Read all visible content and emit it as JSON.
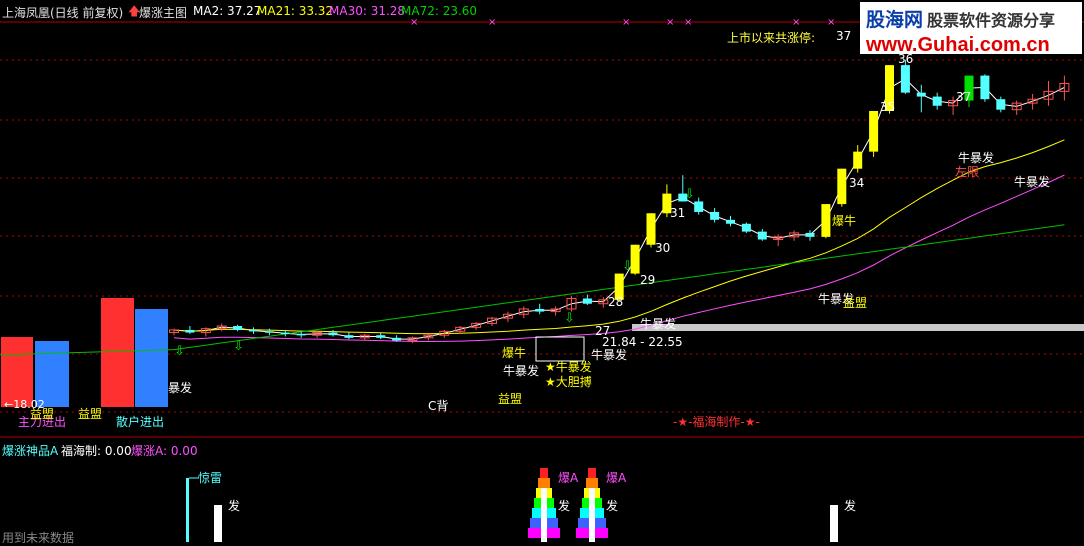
{
  "header": {
    "stock": "上海凤凰(日线 前复权)",
    "indicator": "爆涨主图",
    "ma2": "MA2: 37.27",
    "ma21": "MA21: 33.32",
    "ma30": "MA30: 31.28",
    "ma72": "MA72: 23.60"
  },
  "since_listing": {
    "label": "上市以来共涨停:",
    "value": "37"
  },
  "logo": {
    "cn_main": "股海网",
    "cn_sub": "股票软件资源分享",
    "url": "www.Guhai.com.cn"
  },
  "annotations": {
    "zhuli": "主力进出",
    "sanhu": "散户进出",
    "yimeng": "益盟",
    "wanjia": "←18.02",
    "baofa": "暴发",
    "niubaofa": "牛暴发",
    "baoniu": "爆牛",
    "dadanbo": "大胆搏",
    "cbei": "C背",
    "youjiang": "左限",
    "range_box": "21.84 - 22.55",
    "credit": "-★-福海制作-★-",
    "xin": "★",
    "n31": "31",
    "n30": "30",
    "n29": "29",
    "n34": "34",
    "n35": "35",
    "n36": "36",
    "n37": "37",
    "n28": "28",
    "n27": "27"
  },
  "sub_panel": {
    "title": "爆涨神品A",
    "fuhai": "福海制: 0.00",
    "baozhangA": "爆涨A: 0.00",
    "jinglei": "惊雷",
    "fa": "发",
    "baoA": "爆A",
    "future": "用到未来数据"
  },
  "colors": {
    "up": "#ff5050",
    "down": "#54ffff",
    "yellow": "#ffff00",
    "ma2": "#ffffff",
    "ma21": "#ffff00",
    "ma30": "#ff50ff",
    "ma72": "#00c000",
    "grid": "#b40000"
  },
  "chart_data": {
    "type": "candlestick",
    "title": "爆涨主图",
    "ylim": [
      12,
      39
    ],
    "series_ma": [
      {
        "name": "MA2",
        "value": 37.27
      },
      {
        "name": "MA21",
        "value": 33.32
      },
      {
        "name": "MA30",
        "value": 31.28
      },
      {
        "name": "MA72",
        "value": 23.6
      }
    ],
    "candles": [
      [
        17.6,
        17.9,
        17.4,
        17.8
      ],
      [
        17.8,
        18.1,
        17.5,
        17.6
      ],
      [
        17.6,
        18.0,
        17.3,
        17.9
      ],
      [
        17.9,
        18.3,
        17.7,
        18.1
      ],
      [
        18.1,
        18.2,
        17.7,
        17.8
      ],
      [
        17.8,
        18.0,
        17.5,
        17.7
      ],
      [
        17.7,
        17.9,
        17.4,
        17.6
      ],
      [
        17.6,
        17.8,
        17.3,
        17.5
      ],
      [
        17.5,
        17.7,
        17.2,
        17.4
      ],
      [
        17.4,
        17.7,
        17.2,
        17.6
      ],
      [
        17.6,
        17.8,
        17.3,
        17.4
      ],
      [
        17.4,
        17.6,
        17.1,
        17.2
      ],
      [
        17.2,
        17.5,
        17.0,
        17.4
      ],
      [
        17.4,
        17.6,
        17.1,
        17.2
      ],
      [
        17.2,
        17.4,
        16.9,
        17.0
      ],
      [
        17.0,
        17.3,
        16.8,
        17.2
      ],
      [
        17.2,
        17.5,
        17.0,
        17.4
      ],
      [
        17.4,
        17.8,
        17.2,
        17.7
      ],
      [
        17.7,
        18.1,
        17.5,
        18.0
      ],
      [
        18.0,
        18.4,
        17.8,
        18.3
      ],
      [
        18.3,
        18.8,
        18.1,
        18.7
      ],
      [
        18.7,
        19.2,
        18.4,
        19.0
      ],
      [
        19.0,
        19.6,
        18.7,
        19.4
      ],
      [
        19.4,
        19.8,
        19.0,
        19.2
      ],
      [
        19.2,
        19.6,
        18.9,
        19.4
      ],
      [
        19.4,
        20.4,
        19.2,
        20.2
      ],
      [
        20.2,
        20.5,
        19.7,
        19.8
      ],
      [
        19.8,
        20.3,
        19.5,
        20.1
      ],
      [
        20.1,
        22.1,
        20.0,
        22.1
      ],
      [
        22.1,
        24.3,
        22.0,
        24.3
      ],
      [
        24.3,
        26.7,
        24.1,
        26.7
      ],
      [
        26.7,
        28.9,
        26.4,
        28.2
      ],
      [
        28.2,
        29.6,
        27.6,
        27.6
      ],
      [
        27.6,
        27.9,
        26.6,
        26.8
      ],
      [
        26.8,
        27.1,
        26.0,
        26.2
      ],
      [
        26.2,
        26.5,
        25.7,
        25.9
      ],
      [
        25.9,
        26.0,
        25.2,
        25.3
      ],
      [
        25.3,
        25.5,
        24.6,
        24.7
      ],
      [
        24.7,
        25.1,
        24.2,
        24.9
      ],
      [
        24.9,
        25.4,
        24.6,
        25.2
      ],
      [
        25.2,
        25.4,
        24.6,
        24.9
      ],
      [
        24.9,
        27.4,
        24.8,
        27.4
      ],
      [
        27.4,
        30.1,
        27.2,
        30.1
      ],
      [
        30.1,
        31.9,
        29.8,
        31.4
      ],
      [
        31.4,
        34.5,
        31.0,
        34.5
      ],
      [
        34.5,
        38.0,
        34.3,
        38.0
      ],
      [
        38.0,
        38.4,
        35.8,
        35.9
      ],
      [
        35.9,
        36.5,
        34.4,
        35.6
      ],
      [
        35.6,
        35.9,
        34.6,
        34.9
      ],
      [
        34.9,
        35.6,
        34.2,
        35.3
      ],
      [
        35.3,
        37.2,
        34.8,
        37.2
      ],
      [
        37.2,
        37.3,
        35.2,
        35.4
      ],
      [
        35.4,
        35.6,
        34.4,
        34.6
      ],
      [
        34.6,
        35.3,
        34.2,
        35.1
      ],
      [
        35.1,
        35.8,
        34.6,
        35.4
      ],
      [
        35.4,
        36.8,
        34.9,
        36.0
      ],
      [
        36.0,
        37.2,
        35.3,
        36.6
      ]
    ],
    "volume_panel": {
      "title": "爆涨神品A",
      "series": [
        {
          "name": "福海制",
          "value": 0.0
        },
        {
          "name": "爆涨A",
          "value": 0.0
        }
      ]
    }
  }
}
